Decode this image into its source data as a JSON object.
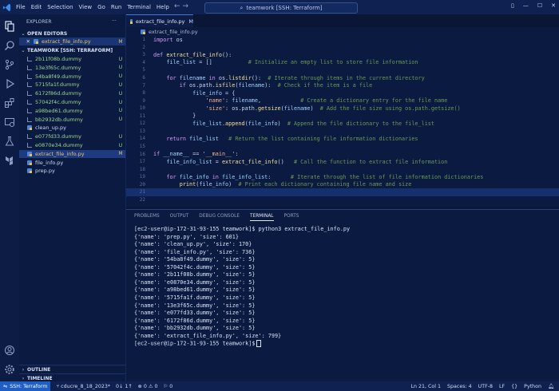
{
  "titlebar": {
    "menu": [
      "File",
      "Edit",
      "Selection",
      "View",
      "Go",
      "Run",
      "Terminal",
      "Help"
    ],
    "command_center": "teamwork [SSH: Terraform]"
  },
  "sidebar": {
    "header": "EXPLORER",
    "open_editors_label": "OPEN EDITORS",
    "open_editor": {
      "name": "extract_file_info.py",
      "badge": "M"
    },
    "workspace_label": "TEAMWORK [SSH: TERRAFORM]",
    "files": [
      {
        "name": "2b11f08b.dummy",
        "badge": "U",
        "type": "dummy",
        "color": "#9fd68a"
      },
      {
        "name": "13e3f65c.dummy",
        "badge": "U",
        "type": "dummy",
        "color": "#9fd68a"
      },
      {
        "name": "54ba8f49.dummy",
        "badge": "U",
        "type": "dummy",
        "color": "#9fd68a"
      },
      {
        "name": "5715fa1f.dummy",
        "badge": "U",
        "type": "dummy",
        "color": "#9fd68a"
      },
      {
        "name": "6172f86d.dummy",
        "badge": "U",
        "type": "dummy",
        "color": "#9fd68a"
      },
      {
        "name": "57042f4c.dummy",
        "badge": "U",
        "type": "dummy",
        "color": "#9fd68a"
      },
      {
        "name": "a98bed61.dummy",
        "badge": "U",
        "type": "dummy",
        "color": "#9fd68a"
      },
      {
        "name": "bb2932db.dummy",
        "badge": "U",
        "type": "dummy",
        "color": "#9fd68a"
      },
      {
        "name": "clean_up.py",
        "badge": "",
        "type": "py",
        "color": "#c9d6f0"
      },
      {
        "name": "e077fd33.dummy",
        "badge": "U",
        "type": "dummy",
        "color": "#9fd68a"
      },
      {
        "name": "e0870e34.dummy",
        "badge": "U",
        "type": "dummy",
        "color": "#9fd68a"
      },
      {
        "name": "extract_file_info.py",
        "badge": "M",
        "type": "py",
        "color": "#e6c36a"
      },
      {
        "name": "file_info.py",
        "badge": "",
        "type": "py",
        "color": "#c9d6f0"
      },
      {
        "name": "prep.py",
        "badge": "",
        "type": "py",
        "color": "#c9d6f0"
      }
    ],
    "outline_label": "OUTLINE",
    "timeline_label": "TIMELINE"
  },
  "editor": {
    "tab": {
      "name": "extract_file_info.py",
      "badge": "M"
    },
    "breadcrumb": "extract_file_info.py",
    "lines": [
      "import os",
      "",
      "def extract_file_info():",
      "    file_list = []           # Initialize an empty list to store file information",
      "",
      "    for filename in os.listdir():  # Iterate through items in the current directory",
      "        if os.path.isfile(filename):  # Check if the item is a file",
      "            file_info = {",
      "                'name': filename,            # Create a dictionary entry for the file name",
      "                'size': os.path.getsize(filename)  # Add the file size using os.path.getsize()",
      "            }",
      "            file_list.append(file_info)  # Append the file dictionary to the file_list",
      "",
      "    return file_list   # Return the list containing file information dictionaries",
      "",
      "if __name__ == '__main__':",
      "    file_info_list = extract_file_info()   # Call the function to extract file information",
      "",
      "    for file_info in file_info_list:      # Iterate through the list of file information dictionaries",
      "        print(file_info)  # Print each dictionary containing file name and size",
      "",
      ""
    ]
  },
  "panel": {
    "tabs": [
      "PROBLEMS",
      "OUTPUT",
      "DEBUG CONSOLE",
      "TERMINAL",
      "PORTS"
    ],
    "active_tab": "TERMINAL",
    "prompt": "[ec2-user@ip-172-31-93-155 teamwork]$",
    "command": " python3 extract_file_info.py",
    "output": [
      "{'name': 'prep.py', 'size': 601}",
      "{'name': 'clean_up.py', 'size': 170}",
      "{'name': 'file_info.py', 'size': 736}",
      "{'name': '54ba8f49.dummy', 'size': 5}",
      "{'name': '57042f4c.dummy', 'size': 5}",
      "{'name': '2b11f08b.dummy', 'size': 5}",
      "{'name': 'e0870e34.dummy', 'size': 5}",
      "{'name': 'a98bed61.dummy', 'size': 5}",
      "{'name': '5715fa1f.dummy', 'size': 5}",
      "{'name': '13e3f65c.dummy', 'size': 5}",
      "{'name': 'e077fd33.dummy', 'size': 5}",
      "{'name': '6172f86d.dummy', 'size': 5}",
      "{'name': 'bb2932db.dummy', 'size': 5}",
      "{'name': 'extract_file_info.py', 'size': 799}"
    ]
  },
  "statusbar": {
    "remote": "SSH: Terraform",
    "branch": "cducre_8_18_2023*",
    "sync": "0↓ 1↑",
    "problems": "⊗ 0 ⚠ 0",
    "ports": "0",
    "position": "Ln 21, Col 1",
    "spaces": "Spaces: 4",
    "encoding": "UTF-8",
    "eol": "LF",
    "language": "Python"
  },
  "colors": {
    "accent": "#1f5fc4",
    "modified": "#e6c36a",
    "untracked": "#9fd68a"
  }
}
